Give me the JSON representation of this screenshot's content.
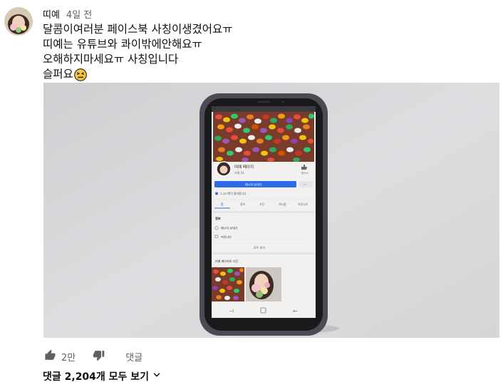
{
  "comment": {
    "author": "띠예",
    "time": "4일 전",
    "lines": [
      "달콤이여러분  페이스북 사칭이생겼어요ㅠ",
      "띠예는 유튜브와 콰이밖에안해요ㅠ",
      "오해하지마세요ㅠ 사칭입니다",
      "슬퍼요"
    ],
    "emoji": "confounded-face-icon"
  },
  "phone_screen": {
    "page_name": "띠예 페이지",
    "page_sub": "띠예 DL",
    "message_button": "메시지 보내기",
    "followers": "3,247명이 좋아합니다",
    "tabs": [
      "홈",
      "정보",
      "사진",
      "게시물",
      "커뮤니티"
    ],
    "section_info": "정보",
    "info_items": [
      "메시지 보내기",
      "커뮤니티"
    ],
    "see_all": "모두 보기",
    "photos_title": "띠예 페이지의 사진"
  },
  "actions": {
    "like_count": "2만",
    "reply_label": "댓글"
  },
  "view_replies": {
    "label": "댓글 2,204개 모두 보기"
  }
}
